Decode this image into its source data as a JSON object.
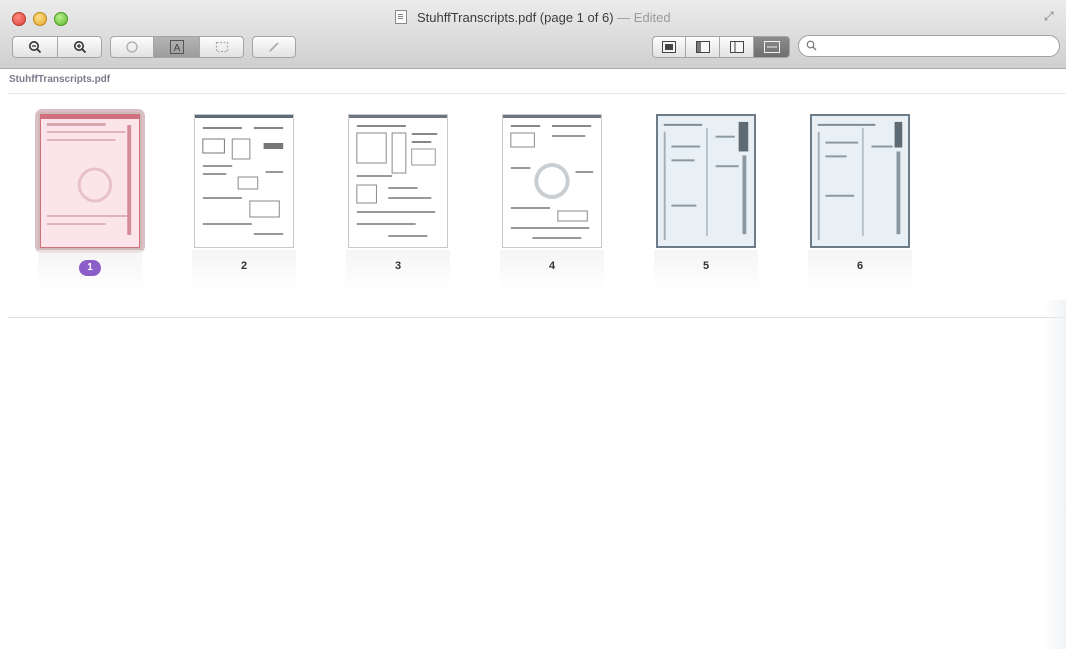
{
  "window": {
    "title_file": "StuhffTranscripts.pdf (page 1 of 6)",
    "title_status": "— Edited",
    "doc_label": "StuhffTranscripts.pdf"
  },
  "toolbar": {
    "zoom_out_icon": "zoom-out-icon",
    "zoom_in_icon": "zoom-in-icon",
    "move_icon": "hand-icon",
    "text_select_label": "A",
    "annotate_icon": "pencil-icon",
    "view_icons": [
      "thumbnail-sidebar-icon",
      "sidebar-icon",
      "single-page-icon",
      "contact-sheet-icon"
    ]
  },
  "search": {
    "placeholder": "",
    "value": ""
  },
  "pages": [
    {
      "number": "1",
      "selected": true
    },
    {
      "number": "2",
      "selected": false
    },
    {
      "number": "3",
      "selected": false
    },
    {
      "number": "4",
      "selected": false
    },
    {
      "number": "5",
      "selected": false
    },
    {
      "number": "6",
      "selected": false
    }
  ],
  "colors": {
    "selection_badge": "#8b5fc7",
    "selected_page_tint": "#f7dfe4"
  }
}
